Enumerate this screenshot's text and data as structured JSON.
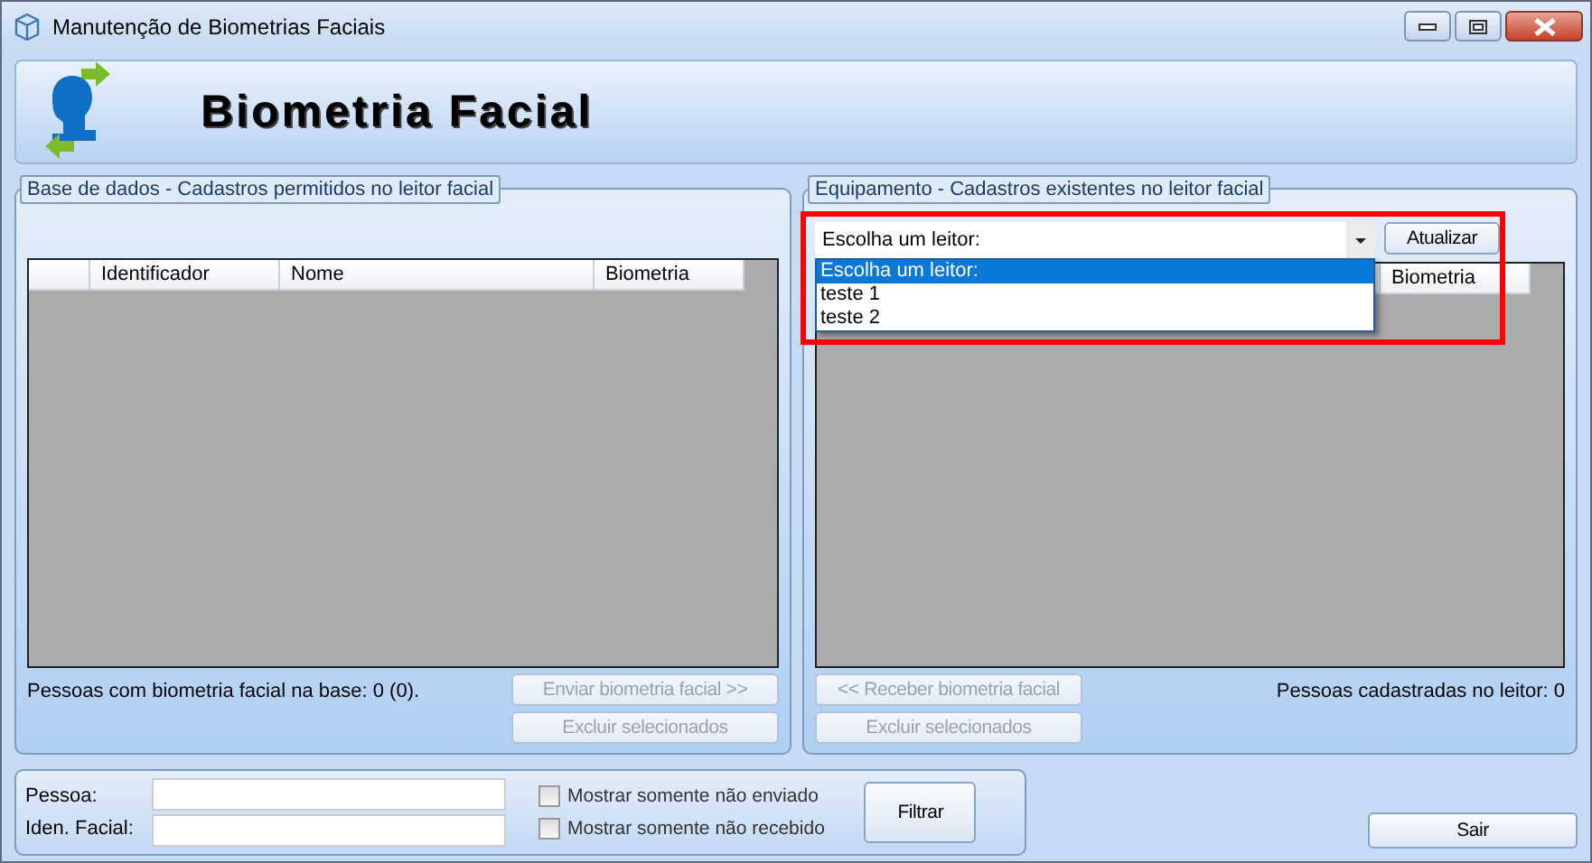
{
  "window": {
    "title": "Manutenção de Biometrias Faciais"
  },
  "banner": {
    "title": "Biometria Facial"
  },
  "database_panel": {
    "legend": "Base de dados - Cadastros permitidos no leitor facial",
    "table": {
      "columns": [
        "Identificador",
        "Nome",
        "Biometria"
      ]
    },
    "summary": "Pessoas com biometria facial na base:  0 (0).",
    "buttons": [
      {
        "label": "Enviar biometria facial >>",
        "disabled": true
      },
      {
        "label": "Excluir selecionados",
        "disabled": true
      }
    ]
  },
  "device_panel": {
    "legend": "Equipamento - Cadastros existentes no leitor facial",
    "highlighted": true,
    "reader_select": {
      "value": "Escolha um leitor:",
      "expanded": true,
      "options": [
        {
          "label": "Escolha um leitor:",
          "selected": true
        },
        {
          "label": "teste 1",
          "selected": false
        },
        {
          "label": "teste 2",
          "selected": false
        }
      ]
    },
    "refresh_button": {
      "label": "Atualizar",
      "disabled": false
    },
    "table": {
      "columns": [
        "Biometria"
      ]
    },
    "summary": "Pessoas cadastradas no leitor: 0",
    "buttons": [
      {
        "label": "<< Receber biometria facial",
        "disabled": true
      },
      {
        "label": "Excluir selecionados",
        "disabled": true
      }
    ]
  },
  "filter": {
    "fields": [
      {
        "label": "Pessoa:"
      },
      {
        "label": "Iden. Facial:"
      }
    ],
    "checkboxes": [
      {
        "label": "Mostrar somente não enviado",
        "checked": false
      },
      {
        "label": "Mostrar somente não recebido",
        "checked": false
      }
    ],
    "button": {
      "label": "Filtrar",
      "disabled": false
    }
  },
  "exit_button": {
    "label": "Sair",
    "disabled": false
  }
}
